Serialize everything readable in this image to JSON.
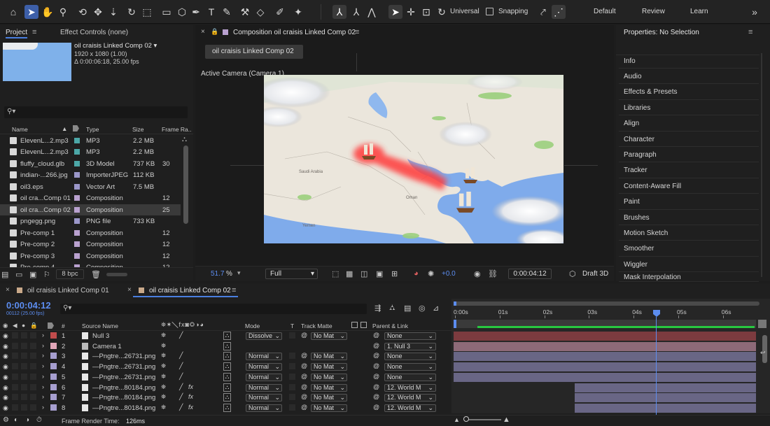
{
  "toolbar": {
    "universal_label": "Universal",
    "snapping_label": "Snapping",
    "workspaces": [
      "Default",
      "Review",
      "Learn"
    ]
  },
  "project": {
    "tab_project": "Project",
    "tab_effect_controls": "Effect Controls (none)",
    "comp_name": "oil craisis Linked Comp 02",
    "comp_resolution": "1920 x 1080 (1.00)",
    "comp_duration": "Δ 0:00:06:18, 25.00 fps",
    "search_placeholder": "",
    "columns": {
      "name": "Name",
      "type": "Type",
      "size": "Size",
      "frame_rate": "Frame Ra.."
    },
    "items": [
      {
        "name": "ElevenL...2.mp3",
        "type": "MP3",
        "size": "2.2 MB",
        "fps": "",
        "color": "#4ca7a7",
        "icon": "file-icon"
      },
      {
        "name": "ElevenL...2.mp3",
        "type": "MP3",
        "size": "2.2 MB",
        "fps": "",
        "color": "#4ca7a7",
        "icon": "file-icon"
      },
      {
        "name": "fluffy_cloud.glb",
        "type": "3D Model",
        "size": "737 KB",
        "fps": "30",
        "color": "#4ca7a7",
        "icon": "3d-model-icon"
      },
      {
        "name": "indian-...266.jpg",
        "type": "ImporterJPEG",
        "size": "112 KB",
        "fps": "",
        "color": "#9b97c9",
        "icon": "image-icon"
      },
      {
        "name": "oil3.eps",
        "type": "Vector Art",
        "size": "7.5 MB",
        "fps": "",
        "color": "#9b97c9",
        "icon": "vector-icon"
      },
      {
        "name": "oil cra...Comp 01",
        "type": "Composition",
        "size": "",
        "fps": "12",
        "color": "#b9a1cf",
        "icon": "composition-icon"
      },
      {
        "name": "oil cra...Comp 02",
        "type": "Composition",
        "size": "",
        "fps": "25",
        "color": "#b9a1cf",
        "icon": "composition-icon"
      },
      {
        "name": "pngegg.png",
        "type": "PNG file",
        "size": "733 KB",
        "fps": "",
        "color": "#9b97c9",
        "icon": "image-icon"
      },
      {
        "name": "Pre-comp 1",
        "type": "Composition",
        "size": "",
        "fps": "12",
        "color": "#b9a1cf",
        "icon": "composition-icon"
      },
      {
        "name": "Pre-comp 2",
        "type": "Composition",
        "size": "",
        "fps": "12",
        "color": "#b9a1cf",
        "icon": "composition-icon"
      },
      {
        "name": "Pre-comp 3",
        "type": "Composition",
        "size": "",
        "fps": "12",
        "color": "#b9a1cf",
        "icon": "composition-icon"
      },
      {
        "name": "Pre-comp 4",
        "type": "Composition",
        "size": "",
        "fps": "12",
        "color": "#b9a1cf",
        "icon": "composition-icon"
      }
    ],
    "bpc": "8 bpc"
  },
  "composition": {
    "tab_title": "Composition oil craisis Linked Comp 02",
    "sub_tab": "oil craisis Linked Comp 02",
    "camera_label": "Active Camera (Camera 1)",
    "map_labels": [
      "Saudi Arabia",
      "Oman",
      "Yemen"
    ],
    "zoom": "51.7",
    "zoom_unit": "%",
    "resolution": "Full",
    "exposure": "+0.0",
    "timecode": "0:00:04:12",
    "renderer": "Draft 3D"
  },
  "properties": {
    "title": "Properties: No Selection",
    "items": [
      "Info",
      "Audio",
      "Effects & Presets",
      "Libraries",
      "Align",
      "Character",
      "Paragraph",
      "Tracker",
      "Content-Aware Fill",
      "Paint",
      "Brushes",
      "Motion Sketch",
      "Smoother",
      "Wiggler",
      "Mask Interpolation"
    ]
  },
  "timeline": {
    "tabs": [
      "oil craisis Linked Comp 01",
      "oil craisis Linked Comp 02"
    ],
    "timecode": "0:00:04:12",
    "timecode_sub": "00112 (25.00 fps)",
    "ruler": [
      "0:00s",
      "01s",
      "02s",
      "03s",
      "04s",
      "05s",
      "06s"
    ],
    "columns": {
      "hash": "#",
      "source": "Source Name",
      "mode": "Mode",
      "t": "T",
      "track_matte": "Track Matte",
      "parent": "Parent & Link"
    },
    "layers": [
      {
        "num": "1",
        "name": "Null 3",
        "mode": "Dissolve",
        "matte": "No Mat",
        "parent": "None",
        "color": "#c14c4c",
        "bar": "#7c3b3f",
        "bar_start": 0.0,
        "fx": false
      },
      {
        "num": "2",
        "name": "Camera 1",
        "mode": "",
        "matte": "",
        "parent": "1. Null 3",
        "color": "#e2a7b9",
        "bar": "#8d6a78",
        "bar_start": 0.0,
        "fx": false
      },
      {
        "num": "3",
        "name": "—Pngtre...26731.png",
        "mode": "Normal",
        "matte": "No Mat",
        "parent": "None",
        "color": "#a79fd0",
        "bar": "#696685",
        "bar_start": 0.0,
        "fx": false
      },
      {
        "num": "4",
        "name": "—Pngtre...26731.png",
        "mode": "Normal",
        "matte": "No Mat",
        "parent": "None",
        "color": "#a79fd0",
        "bar": "#696685",
        "bar_start": 0.0,
        "fx": false
      },
      {
        "num": "5",
        "name": "—Pngtre...26731.png",
        "mode": "Normal",
        "matte": "No Mat",
        "parent": "None",
        "color": "#a79fd0",
        "bar": "#696685",
        "bar_start": 0.0,
        "fx": false
      },
      {
        "num": "6",
        "name": "—Pngtre...80184.png",
        "mode": "Normal",
        "matte": "No Mat",
        "parent": "12. World M",
        "color": "#a79fd0",
        "bar": "#696685",
        "bar_start": 0.4,
        "fx": true
      },
      {
        "num": "7",
        "name": "—Pngtre...80184.png",
        "mode": "Normal",
        "matte": "No Mat",
        "parent": "12. World M",
        "color": "#a79fd0",
        "bar": "#696685",
        "bar_start": 0.4,
        "fx": true
      },
      {
        "num": "8",
        "name": "—Pngtre...80184.png",
        "mode": "Normal",
        "matte": "No Mat",
        "parent": "12. World M",
        "color": "#a79fd0",
        "bar": "#696685",
        "bar_start": 0.4,
        "fx": true
      }
    ],
    "frame_render_label": "Frame Render Time:",
    "frame_render_value": "126ms"
  }
}
